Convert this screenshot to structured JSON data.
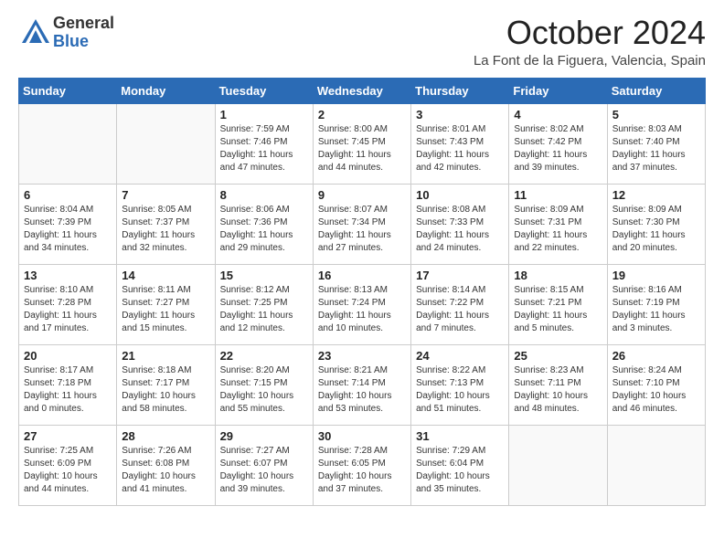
{
  "header": {
    "logo": {
      "general": "General",
      "blue": "Blue"
    },
    "title": "October 2024",
    "location": "La Font de la Figuera, Valencia, Spain"
  },
  "weekdays": [
    "Sunday",
    "Monday",
    "Tuesday",
    "Wednesday",
    "Thursday",
    "Friday",
    "Saturday"
  ],
  "weeks": [
    [
      {
        "day": "",
        "sunrise": "",
        "sunset": "",
        "daylight": ""
      },
      {
        "day": "",
        "sunrise": "",
        "sunset": "",
        "daylight": ""
      },
      {
        "day": "1",
        "sunrise": "Sunrise: 7:59 AM",
        "sunset": "Sunset: 7:46 PM",
        "daylight": "Daylight: 11 hours and 47 minutes."
      },
      {
        "day": "2",
        "sunrise": "Sunrise: 8:00 AM",
        "sunset": "Sunset: 7:45 PM",
        "daylight": "Daylight: 11 hours and 44 minutes."
      },
      {
        "day": "3",
        "sunrise": "Sunrise: 8:01 AM",
        "sunset": "Sunset: 7:43 PM",
        "daylight": "Daylight: 11 hours and 42 minutes."
      },
      {
        "day": "4",
        "sunrise": "Sunrise: 8:02 AM",
        "sunset": "Sunset: 7:42 PM",
        "daylight": "Daylight: 11 hours and 39 minutes."
      },
      {
        "day": "5",
        "sunrise": "Sunrise: 8:03 AM",
        "sunset": "Sunset: 7:40 PM",
        "daylight": "Daylight: 11 hours and 37 minutes."
      }
    ],
    [
      {
        "day": "6",
        "sunrise": "Sunrise: 8:04 AM",
        "sunset": "Sunset: 7:39 PM",
        "daylight": "Daylight: 11 hours and 34 minutes."
      },
      {
        "day": "7",
        "sunrise": "Sunrise: 8:05 AM",
        "sunset": "Sunset: 7:37 PM",
        "daylight": "Daylight: 11 hours and 32 minutes."
      },
      {
        "day": "8",
        "sunrise": "Sunrise: 8:06 AM",
        "sunset": "Sunset: 7:36 PM",
        "daylight": "Daylight: 11 hours and 29 minutes."
      },
      {
        "day": "9",
        "sunrise": "Sunrise: 8:07 AM",
        "sunset": "Sunset: 7:34 PM",
        "daylight": "Daylight: 11 hours and 27 minutes."
      },
      {
        "day": "10",
        "sunrise": "Sunrise: 8:08 AM",
        "sunset": "Sunset: 7:33 PM",
        "daylight": "Daylight: 11 hours and 24 minutes."
      },
      {
        "day": "11",
        "sunrise": "Sunrise: 8:09 AM",
        "sunset": "Sunset: 7:31 PM",
        "daylight": "Daylight: 11 hours and 22 minutes."
      },
      {
        "day": "12",
        "sunrise": "Sunrise: 8:09 AM",
        "sunset": "Sunset: 7:30 PM",
        "daylight": "Daylight: 11 hours and 20 minutes."
      }
    ],
    [
      {
        "day": "13",
        "sunrise": "Sunrise: 8:10 AM",
        "sunset": "Sunset: 7:28 PM",
        "daylight": "Daylight: 11 hours and 17 minutes."
      },
      {
        "day": "14",
        "sunrise": "Sunrise: 8:11 AM",
        "sunset": "Sunset: 7:27 PM",
        "daylight": "Daylight: 11 hours and 15 minutes."
      },
      {
        "day": "15",
        "sunrise": "Sunrise: 8:12 AM",
        "sunset": "Sunset: 7:25 PM",
        "daylight": "Daylight: 11 hours and 12 minutes."
      },
      {
        "day": "16",
        "sunrise": "Sunrise: 8:13 AM",
        "sunset": "Sunset: 7:24 PM",
        "daylight": "Daylight: 11 hours and 10 minutes."
      },
      {
        "day": "17",
        "sunrise": "Sunrise: 8:14 AM",
        "sunset": "Sunset: 7:22 PM",
        "daylight": "Daylight: 11 hours and 7 minutes."
      },
      {
        "day": "18",
        "sunrise": "Sunrise: 8:15 AM",
        "sunset": "Sunset: 7:21 PM",
        "daylight": "Daylight: 11 hours and 5 minutes."
      },
      {
        "day": "19",
        "sunrise": "Sunrise: 8:16 AM",
        "sunset": "Sunset: 7:19 PM",
        "daylight": "Daylight: 11 hours and 3 minutes."
      }
    ],
    [
      {
        "day": "20",
        "sunrise": "Sunrise: 8:17 AM",
        "sunset": "Sunset: 7:18 PM",
        "daylight": "Daylight: 11 hours and 0 minutes."
      },
      {
        "day": "21",
        "sunrise": "Sunrise: 8:18 AM",
        "sunset": "Sunset: 7:17 PM",
        "daylight": "Daylight: 10 hours and 58 minutes."
      },
      {
        "day": "22",
        "sunrise": "Sunrise: 8:20 AM",
        "sunset": "Sunset: 7:15 PM",
        "daylight": "Daylight: 10 hours and 55 minutes."
      },
      {
        "day": "23",
        "sunrise": "Sunrise: 8:21 AM",
        "sunset": "Sunset: 7:14 PM",
        "daylight": "Daylight: 10 hours and 53 minutes."
      },
      {
        "day": "24",
        "sunrise": "Sunrise: 8:22 AM",
        "sunset": "Sunset: 7:13 PM",
        "daylight": "Daylight: 10 hours and 51 minutes."
      },
      {
        "day": "25",
        "sunrise": "Sunrise: 8:23 AM",
        "sunset": "Sunset: 7:11 PM",
        "daylight": "Daylight: 10 hours and 48 minutes."
      },
      {
        "day": "26",
        "sunrise": "Sunrise: 8:24 AM",
        "sunset": "Sunset: 7:10 PM",
        "daylight": "Daylight: 10 hours and 46 minutes."
      }
    ],
    [
      {
        "day": "27",
        "sunrise": "Sunrise: 7:25 AM",
        "sunset": "Sunset: 6:09 PM",
        "daylight": "Daylight: 10 hours and 44 minutes."
      },
      {
        "day": "28",
        "sunrise": "Sunrise: 7:26 AM",
        "sunset": "Sunset: 6:08 PM",
        "daylight": "Daylight: 10 hours and 41 minutes."
      },
      {
        "day": "29",
        "sunrise": "Sunrise: 7:27 AM",
        "sunset": "Sunset: 6:07 PM",
        "daylight": "Daylight: 10 hours and 39 minutes."
      },
      {
        "day": "30",
        "sunrise": "Sunrise: 7:28 AM",
        "sunset": "Sunset: 6:05 PM",
        "daylight": "Daylight: 10 hours and 37 minutes."
      },
      {
        "day": "31",
        "sunrise": "Sunrise: 7:29 AM",
        "sunset": "Sunset: 6:04 PM",
        "daylight": "Daylight: 10 hours and 35 minutes."
      },
      {
        "day": "",
        "sunrise": "",
        "sunset": "",
        "daylight": ""
      },
      {
        "day": "",
        "sunrise": "",
        "sunset": "",
        "daylight": ""
      }
    ]
  ]
}
